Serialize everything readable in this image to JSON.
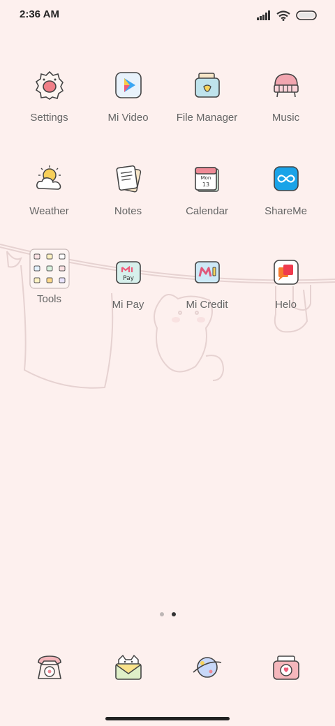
{
  "status_bar": {
    "time": "2:36 AM",
    "icons": [
      "signal-icon",
      "wifi-icon",
      "battery-icon"
    ]
  },
  "apps": [
    {
      "label": "Settings",
      "icon": "settings-icon"
    },
    {
      "label": "Mi Video",
      "icon": "mi-video-icon"
    },
    {
      "label": "File Manager",
      "icon": "file-manager-icon"
    },
    {
      "label": "Music",
      "icon": "music-icon"
    },
    {
      "label": "Weather",
      "icon": "weather-icon"
    },
    {
      "label": "Notes",
      "icon": "notes-icon"
    },
    {
      "label": "Calendar",
      "icon": "calendar-icon",
      "calendar_day": "Mon",
      "calendar_date": "13"
    },
    {
      "label": "ShareMe",
      "icon": "shareme-icon"
    },
    {
      "label": "Tools",
      "icon": "tools-folder-icon"
    },
    {
      "label": "Mi Pay",
      "icon": "mi-pay-icon",
      "icon_text": "Pay"
    },
    {
      "label": "Mi Credit",
      "icon": "mi-credit-icon"
    },
    {
      "label": "Helo",
      "icon": "helo-icon"
    }
  ],
  "page_indicator": {
    "pages": 2,
    "active": 2
  },
  "dock": [
    {
      "icon": "phone-icon"
    },
    {
      "icon": "messages-icon"
    },
    {
      "icon": "browser-icon"
    },
    {
      "icon": "camera-icon"
    }
  ],
  "colors": {
    "background": "#fdf0ee",
    "accent_pink": "#f2a7a8",
    "accent_blue": "#1aa3e8",
    "outline": "#444444"
  }
}
